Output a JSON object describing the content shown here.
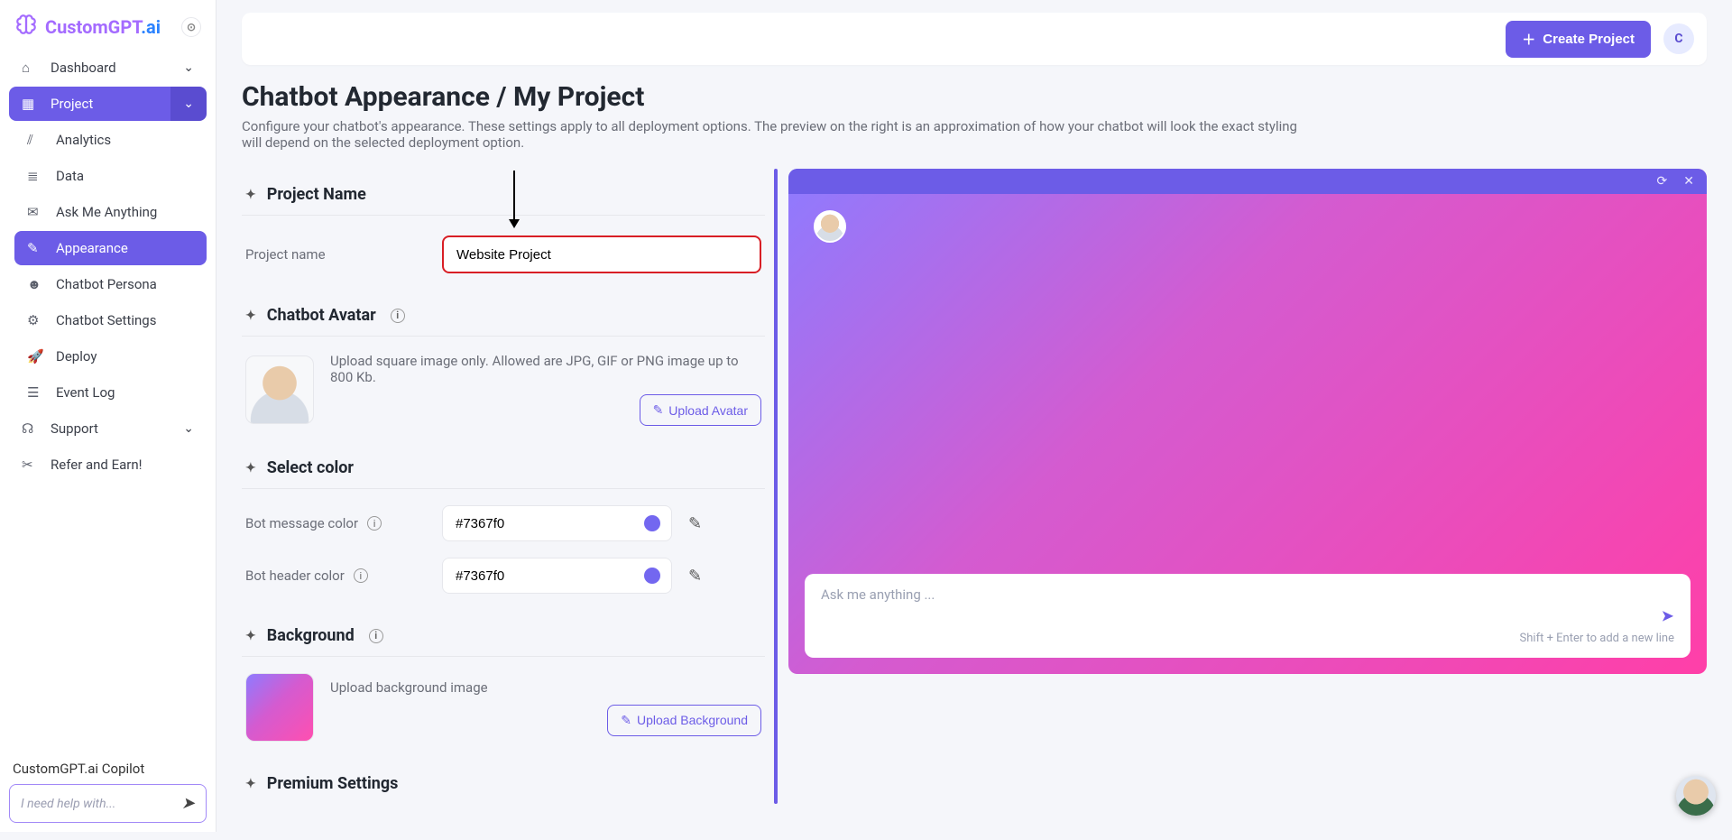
{
  "brand": {
    "name1": "CustomGPT",
    "name2": ".ai"
  },
  "sidebar": {
    "dashboard": "Dashboard",
    "project": "Project",
    "sub": {
      "analytics": "Analytics",
      "data": "Data",
      "ask": "Ask Me Anything",
      "appearance": "Appearance",
      "persona": "Chatbot Persona",
      "settings": "Chatbot Settings",
      "deploy": "Deploy",
      "eventlog": "Event Log"
    },
    "support": "Support",
    "refer": "Refer and Earn!"
  },
  "copilot": {
    "title": "CustomGPT.ai Copilot",
    "placeholder": "I need help with..."
  },
  "topbar": {
    "create_project": "Create Project",
    "user_initial": "C"
  },
  "page": {
    "title": "Chatbot Appearance / My Project",
    "description": "Configure your chatbot's appearance. These settings apply to all deployment options. The preview on the right is an approximation of how your chatbot will look the exact styling will depend on the selected deployment option."
  },
  "form": {
    "project_name_section": "Project Name",
    "project_name_label": "Project name",
    "project_name_value": "Website Project",
    "chatbot_avatar_section": "Chatbot Avatar",
    "avatar_hint": "Upload square image only. Allowed are JPG, GIF or PNG image up to 800 Kb.",
    "upload_avatar": "Upload Avatar",
    "select_color_section": "Select color",
    "bot_message_color_label": "Bot message color",
    "bot_message_color_value": "#7367f0",
    "bot_header_color_label": "Bot header color",
    "bot_header_color_value": "#7367f0",
    "background_section": "Background",
    "background_hint": "Upload background image",
    "upload_background": "Upload Background",
    "premium_section": "Premium Settings"
  },
  "preview": {
    "input_placeholder": "Ask me anything ...",
    "hint": "Shift + Enter to add a new line"
  }
}
